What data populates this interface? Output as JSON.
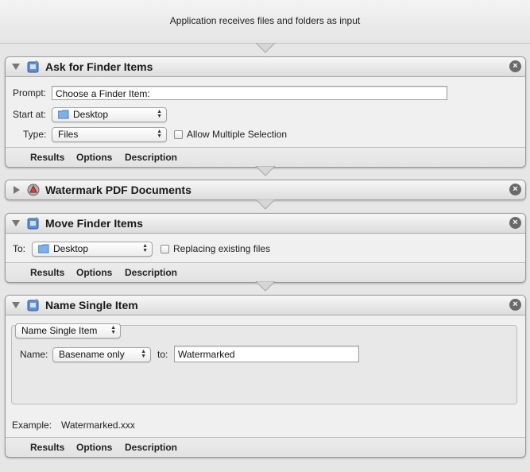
{
  "header": {
    "text": "Application receives files and folders as input"
  },
  "footer_tabs": {
    "results": "Results",
    "options": "Options",
    "description": "Description"
  },
  "actions": {
    "ask": {
      "title": "Ask for Finder Items",
      "prompt_label": "Prompt:",
      "prompt_value": "Choose a Finder Item:",
      "start_label": "Start at:",
      "start_value": "Desktop",
      "type_label": "Type:",
      "type_value": "Files",
      "allow_multiple_label": "Allow Multiple Selection",
      "allow_multiple_checked": false
    },
    "watermark": {
      "title": "Watermark PDF Documents",
      "collapsed": true
    },
    "move": {
      "title": "Move Finder Items",
      "to_label": "To:",
      "to_value": "Desktop",
      "replacing_label": "Replacing existing files",
      "replacing_checked": false
    },
    "name": {
      "title": "Name Single Item",
      "mode_value": "Name Single Item",
      "name_label": "Name:",
      "name_option": "Basename only",
      "to_label": "to:",
      "to_value": "Watermarked",
      "example_label": "Example:",
      "example_value": "Watermarked.xxx"
    }
  },
  "icons": {
    "action_icon": "automator-finder-icon",
    "watermark_icon": "automator-pdf-icon",
    "folder_icon": "desktop-folder-icon",
    "close_icon": "close-x-icon"
  },
  "colors": {
    "background": "#e6e6e6",
    "close_button": "#6a6a6a",
    "panel": "#f0f0f0"
  }
}
